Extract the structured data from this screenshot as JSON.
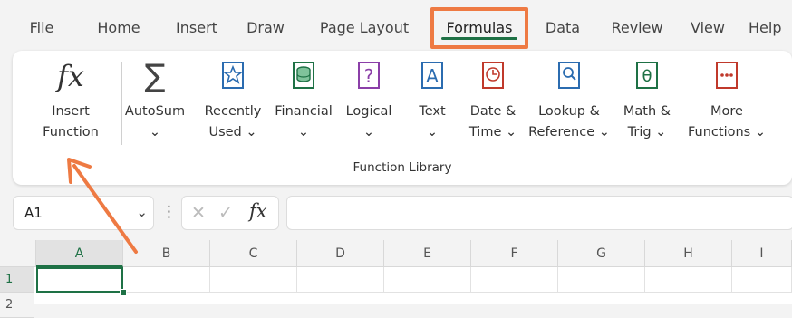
{
  "tabs": [
    "File",
    "Home",
    "Insert",
    "Draw",
    "Page Layout",
    "Formulas",
    "Data",
    "Review",
    "View",
    "Help"
  ],
  "active_tab": "Formulas",
  "ribbon": {
    "insert_function": {
      "line1": "Insert",
      "line2": "Function",
      "icon": "fx"
    },
    "buttons": [
      {
        "line1": "AutoSum",
        "line2": "⌄"
      },
      {
        "line1": "Recently",
        "line2": "Used ⌄"
      },
      {
        "line1": "Financial",
        "line2": "⌄"
      },
      {
        "line1": "Logical",
        "line2": "⌄"
      },
      {
        "line1": "Text",
        "line2": "⌄"
      },
      {
        "line1": "Date &",
        "line2": "Time ⌄"
      },
      {
        "line1": "Lookup &",
        "line2": "Reference ⌄"
      },
      {
        "line1": "Math &",
        "line2": "Trig ⌄"
      },
      {
        "line1": "More",
        "line2": "Functions ⌄"
      }
    ],
    "group_label": "Function Library"
  },
  "formula_bar": {
    "name_box": "A1",
    "name_box_arrow": "⌄",
    "more": "⋮",
    "cancel": "✕",
    "enter": "✓",
    "fx": "fx",
    "value": ""
  },
  "columns": [
    "A",
    "B",
    "C",
    "D",
    "E",
    "F",
    "G",
    "H",
    "I"
  ],
  "rows": [
    "1",
    "2"
  ],
  "colors": {
    "accent": "#1e7145",
    "highlight": "#ee7a43"
  }
}
